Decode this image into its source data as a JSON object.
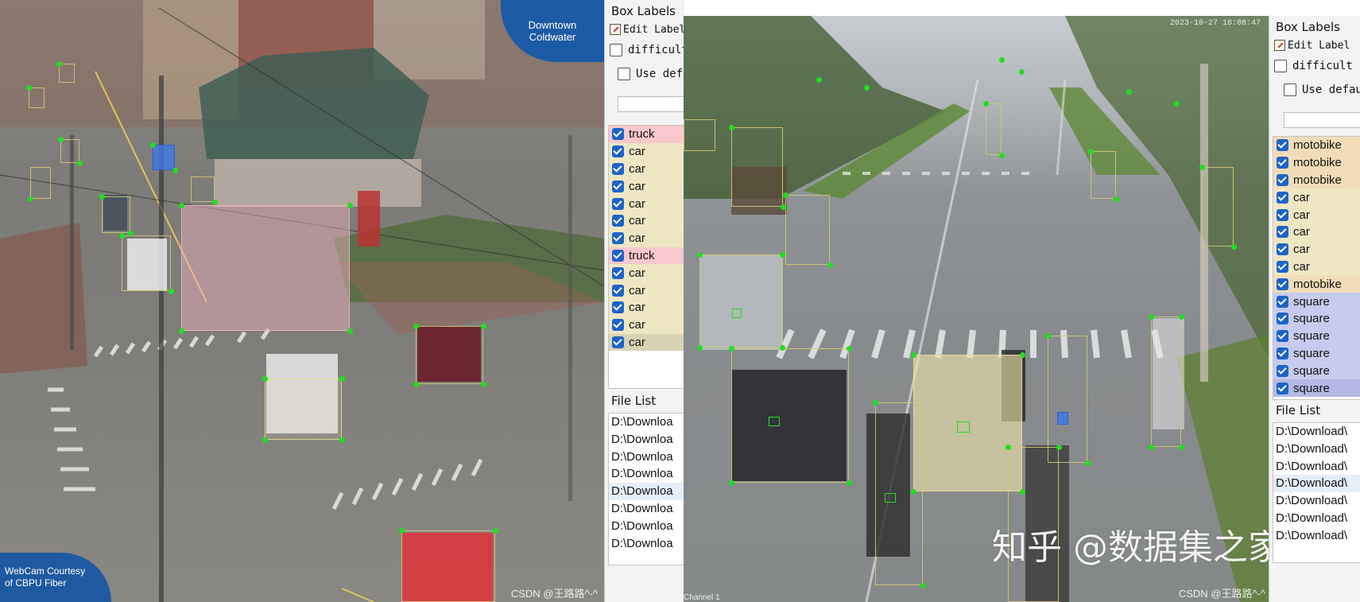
{
  "left_camera": {
    "logo_top": [
      "Downtown",
      "Coldwater"
    ],
    "logo_bottom": [
      "WebCam Courtesy",
      "of CBPU Fiber"
    ],
    "watermark": "CSDN @王路路^-^"
  },
  "right_camera": {
    "timestamp": "2023-10-27 16:08:47",
    "channel": "Channel 1",
    "watermark": "CSDN @王路路^-^",
    "zhihu_watermark": "知乎 @数据集之家"
  },
  "left_panel": {
    "title": "Box Labels",
    "edit_label": "Edit Label",
    "difficult": "difficult",
    "use_default": "Use def",
    "labels": [
      {
        "text": "truck",
        "color": "#f8c8cc"
      },
      {
        "text": "car",
        "color": "#efe6c4"
      },
      {
        "text": "car",
        "color": "#efe6c4"
      },
      {
        "text": "car",
        "color": "#efe6c4"
      },
      {
        "text": "car",
        "color": "#efe6c4"
      },
      {
        "text": "car",
        "color": "#efe6c4"
      },
      {
        "text": "car",
        "color": "#efe6c4"
      },
      {
        "text": "truck",
        "color": "#f8c8cc"
      },
      {
        "text": "car",
        "color": "#efe6c4"
      },
      {
        "text": "car",
        "color": "#efe6c4"
      },
      {
        "text": "car",
        "color": "#efe6c4"
      },
      {
        "text": "car",
        "color": "#efe6c4"
      },
      {
        "text": "car",
        "color": "#d9d3b6"
      }
    ],
    "file_list_title": "File List",
    "files": [
      "D:\\Downloa",
      "D:\\Downloa",
      "D:\\Downloa",
      "D:\\Downloa",
      "D:\\Downloa",
      "D:\\Downloa",
      "D:\\Downloa",
      "D:\\Downloa"
    ]
  },
  "right_panel": {
    "title": "Box Labels",
    "edit_label": "Edit Label",
    "difficult": "difficult",
    "use_default": "Use defau",
    "labels": [
      {
        "text": "motobike",
        "color": "#f1dcb8"
      },
      {
        "text": "motobike",
        "color": "#f1dcb8"
      },
      {
        "text": "motobike",
        "color": "#f1dcb8"
      },
      {
        "text": "car",
        "color": "#efe6c4"
      },
      {
        "text": "car",
        "color": "#efe6c4"
      },
      {
        "text": "car",
        "color": "#efe6c4"
      },
      {
        "text": "car",
        "color": "#efe6c4"
      },
      {
        "text": "car",
        "color": "#efe6c4"
      },
      {
        "text": "motobike",
        "color": "#f1dcb8"
      },
      {
        "text": "square",
        "color": "#c7cbef"
      },
      {
        "text": "square",
        "color": "#c7cbef"
      },
      {
        "text": "square",
        "color": "#c7cbef"
      },
      {
        "text": "square",
        "color": "#c7cbef"
      },
      {
        "text": "square",
        "color": "#c7cbef"
      },
      {
        "text": "square",
        "color": "#b4b9e6"
      }
    ],
    "file_list_title": "File List",
    "files": [
      "D:\\Download\\",
      "D:\\Download\\",
      "D:\\Download\\",
      "D:\\Download\\",
      "D:\\Download\\",
      "D:\\Download\\",
      "D:\\Download\\"
    ]
  }
}
